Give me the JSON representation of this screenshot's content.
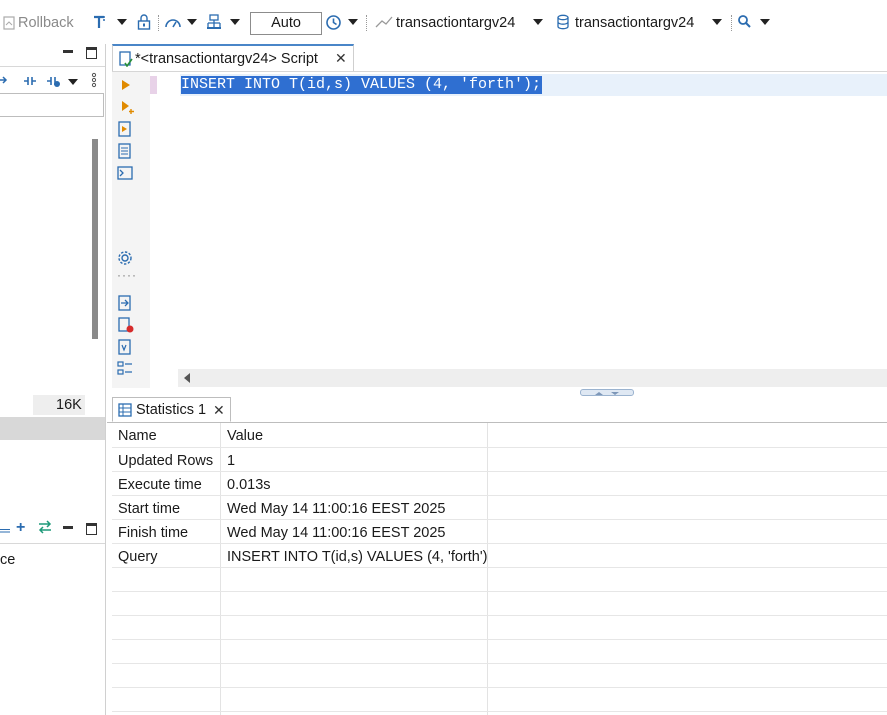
{
  "toolbar": {
    "rollback_label": "Rollback",
    "commit_mode": "Auto",
    "datasource_label": "transactiontargv24",
    "schema_label": "transactiontargv24"
  },
  "left_panel": {
    "size_label": "16K",
    "lower_item_label": "ce"
  },
  "editor": {
    "tab_label": "*<transactiontargv24> Script",
    "code": "INSERT INTO T(id,s) VALUES (4, 'forth');"
  },
  "results": {
    "tab_label": "Statistics 1",
    "columns": [
      "Name",
      "Value"
    ],
    "rows": [
      {
        "name": "Updated Rows",
        "value": "1"
      },
      {
        "name": "Execute time",
        "value": "0.013s"
      },
      {
        "name": "Start time",
        "value": "Wed May 14 11:00:16 EEST 2025"
      },
      {
        "name": "Finish time",
        "value": "Wed May 14 11:00:16 EEST 2025"
      },
      {
        "name": "Query",
        "value": "INSERT INTO T(id,s) VALUES (4, 'forth')"
      }
    ]
  }
}
